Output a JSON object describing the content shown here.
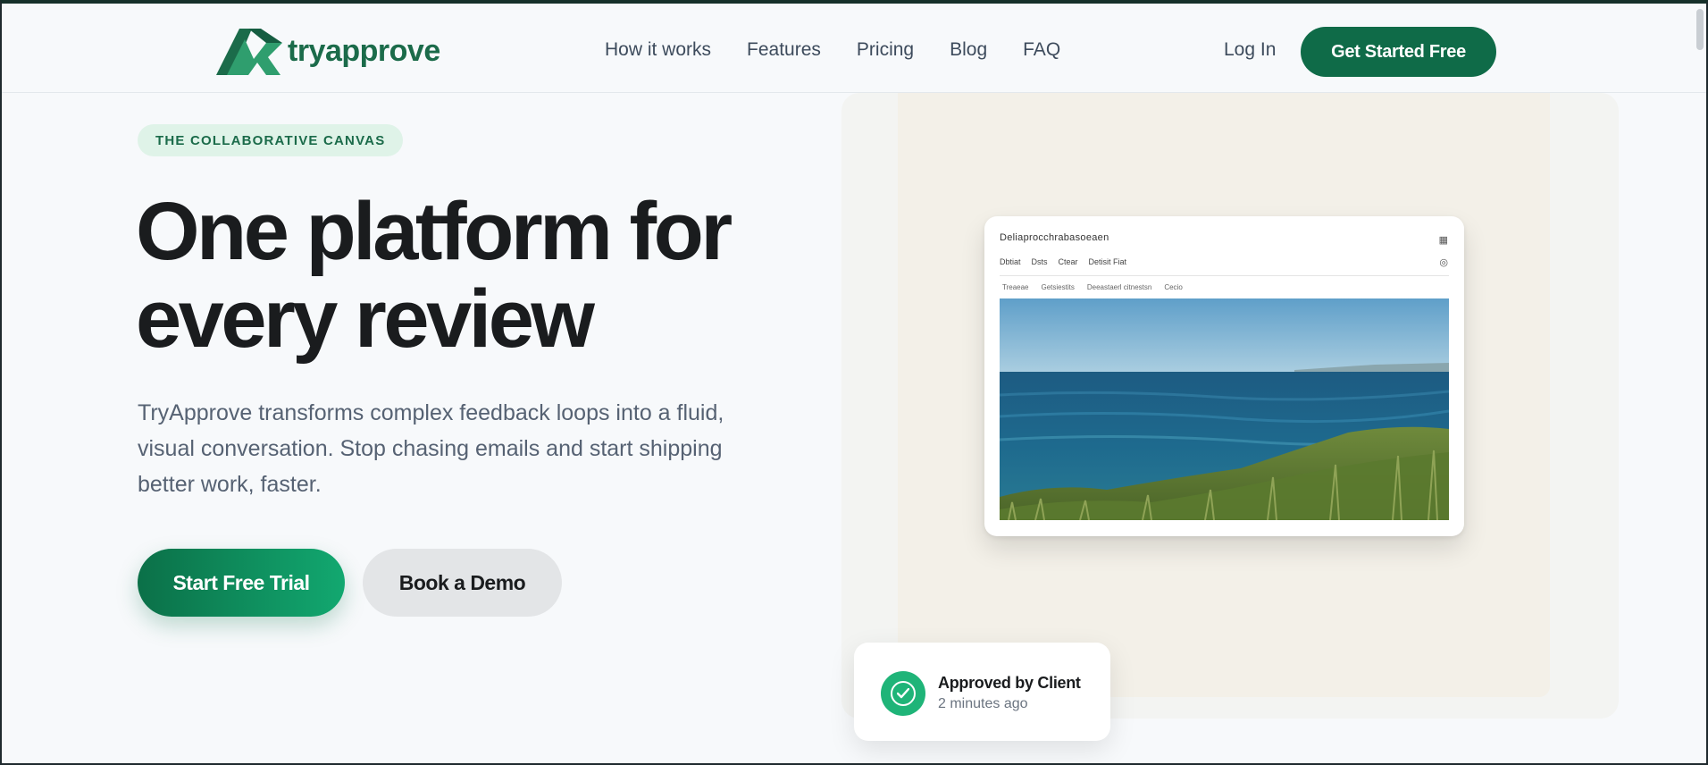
{
  "header": {
    "logo_text": "tryapprove",
    "nav": [
      {
        "label": "How it works"
      },
      {
        "label": "Features"
      },
      {
        "label": "Pricing"
      },
      {
        "label": "Blog"
      },
      {
        "label": "FAQ"
      }
    ],
    "login_label": "Log In",
    "cta_label": "Get Started Free"
  },
  "hero": {
    "eyebrow": "THE COLLABORATIVE CANVAS",
    "headline_line1": "One platform for",
    "headline_line2": "every review",
    "subtext": "TryApprove transforms complex feedback loops into a fluid, visual conversation. Stop chasing emails and start shipping better work, faster.",
    "primary_button": "Start Free Trial",
    "secondary_button": "Book a Demo"
  },
  "preview": {
    "window_title": "Deliaprocchrabasoeaen",
    "menu": [
      "Dbtiat",
      "Dsts",
      "Ctear",
      "Detisit Fiat"
    ],
    "tabs": [
      "Treaeae",
      "Getsiestits",
      "Deeastaerl citnestsn",
      "Cecio"
    ]
  },
  "toast": {
    "title": "Approved by Client",
    "time": "2 minutes ago"
  },
  "colors": {
    "brand": "#0f6b48",
    "brand_light": "#12a870",
    "eyebrow_bg": "#dff3e8",
    "text_dark": "#1a1c1e",
    "text_muted": "#566273",
    "success": "#1fb478"
  }
}
